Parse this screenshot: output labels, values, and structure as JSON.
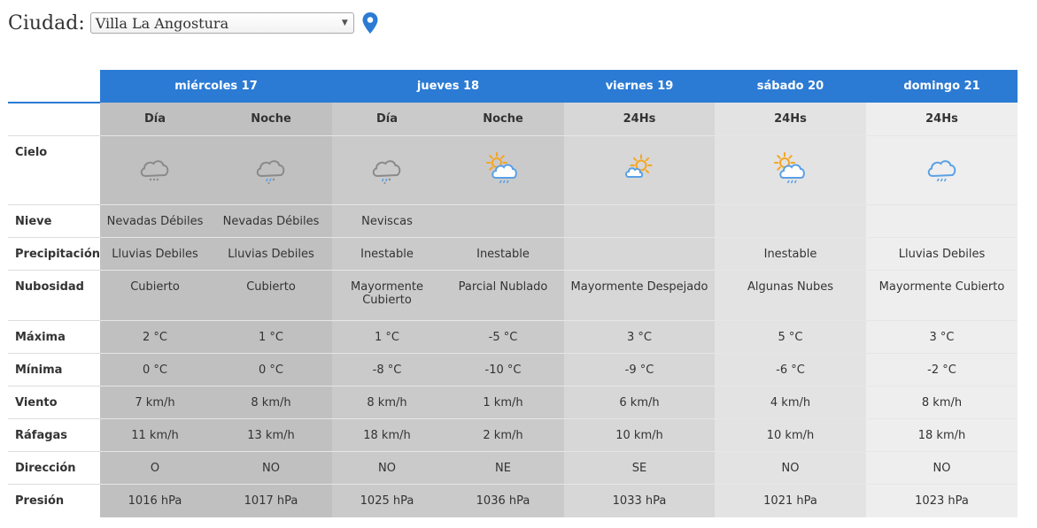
{
  "city": {
    "label": "Ciudad:",
    "selected": "Villa La Angostura"
  },
  "days": [
    {
      "name": "miércoles 17",
      "periods": [
        "Día",
        "Noche"
      ]
    },
    {
      "name": "jueves 18",
      "periods": [
        "Día",
        "Noche"
      ]
    },
    {
      "name": "viernes 19",
      "periods": [
        "24Hs"
      ]
    },
    {
      "name": "sábado 20",
      "periods": [
        "24Hs"
      ]
    },
    {
      "name": "domingo 21",
      "periods": [
        "24Hs"
      ]
    }
  ],
  "row_labels": {
    "cielo": "Cielo",
    "nieve": "Nieve",
    "precipitacion": "Precipitación",
    "nubosidad": "Nubosidad",
    "maxima": "Máxima",
    "minima": "Mínima",
    "viento": "Viento",
    "rafagas": "Ráfagas",
    "direccion": "Dirección",
    "presion": "Presión"
  },
  "columns": [
    {
      "icon": "cloud-snow-icon",
      "nieve": "Nevadas Débiles",
      "precipitacion": "Lluvias Debiles",
      "nubosidad": "Cubierto",
      "maxima": "2 °C",
      "minima": "0 °C",
      "viento": "7 km/h",
      "rafagas": "11 km/h",
      "direccion": "O",
      "presion": "1016 hPa"
    },
    {
      "icon": "cloud-sleet-icon",
      "nieve": "Nevadas Débiles",
      "precipitacion": "Lluvias Debiles",
      "nubosidad": "Cubierto",
      "maxima": "1 °C",
      "minima": "0 °C",
      "viento": "8 km/h",
      "rafagas": "13 km/h",
      "direccion": "NO",
      "presion": "1017 hPa"
    },
    {
      "icon": "cloud-sleet-icon",
      "nieve": "Neviscas",
      "precipitacion": "Inestable",
      "nubosidad": "Mayormente Cubierto",
      "maxima": "1 °C",
      "minima": "-8 °C",
      "viento": "8 km/h",
      "rafagas": "18 km/h",
      "direccion": "NO",
      "presion": "1025 hPa"
    },
    {
      "icon": "sun-cloud-rain-icon",
      "nieve": "",
      "precipitacion": "Inestable",
      "nubosidad": "Parcial Nublado",
      "maxima": "-5 °C",
      "minima": "-10 °C",
      "viento": "1 km/h",
      "rafagas": "2 km/h",
      "direccion": "NE",
      "presion": "1036 hPa"
    },
    {
      "icon": "sun-small-cloud-icon",
      "nieve": "",
      "precipitacion": "",
      "nubosidad": "Mayormente Despejado",
      "maxima": "3 °C",
      "minima": "-9 °C",
      "viento": "6 km/h",
      "rafagas": "10 km/h",
      "direccion": "SE",
      "presion": "1033 hPa"
    },
    {
      "icon": "sun-cloud-rain-icon",
      "nieve": "",
      "precipitacion": "Inestable",
      "nubosidad": "Algunas Nubes",
      "maxima": "5 °C",
      "minima": "-6 °C",
      "viento": "4 km/h",
      "rafagas": "10 km/h",
      "direccion": "NO",
      "presion": "1021 hPa"
    },
    {
      "icon": "cloud-rain-icon",
      "nieve": "",
      "precipitacion": "Lluvias Debiles",
      "nubosidad": "Mayormente Cubierto",
      "maxima": "3 °C",
      "minima": "-2 °C",
      "viento": "8 km/h",
      "rafagas": "18 km/h",
      "direccion": "NO",
      "presion": "1023 hPa"
    }
  ],
  "colors": {
    "header_blue": "#2b7bd4",
    "pin_blue": "#2b7bd4",
    "sun_orange": "#f5a623",
    "cloud_blue": "#5aa0e6",
    "cloud_gray": "#8a8a8a"
  }
}
